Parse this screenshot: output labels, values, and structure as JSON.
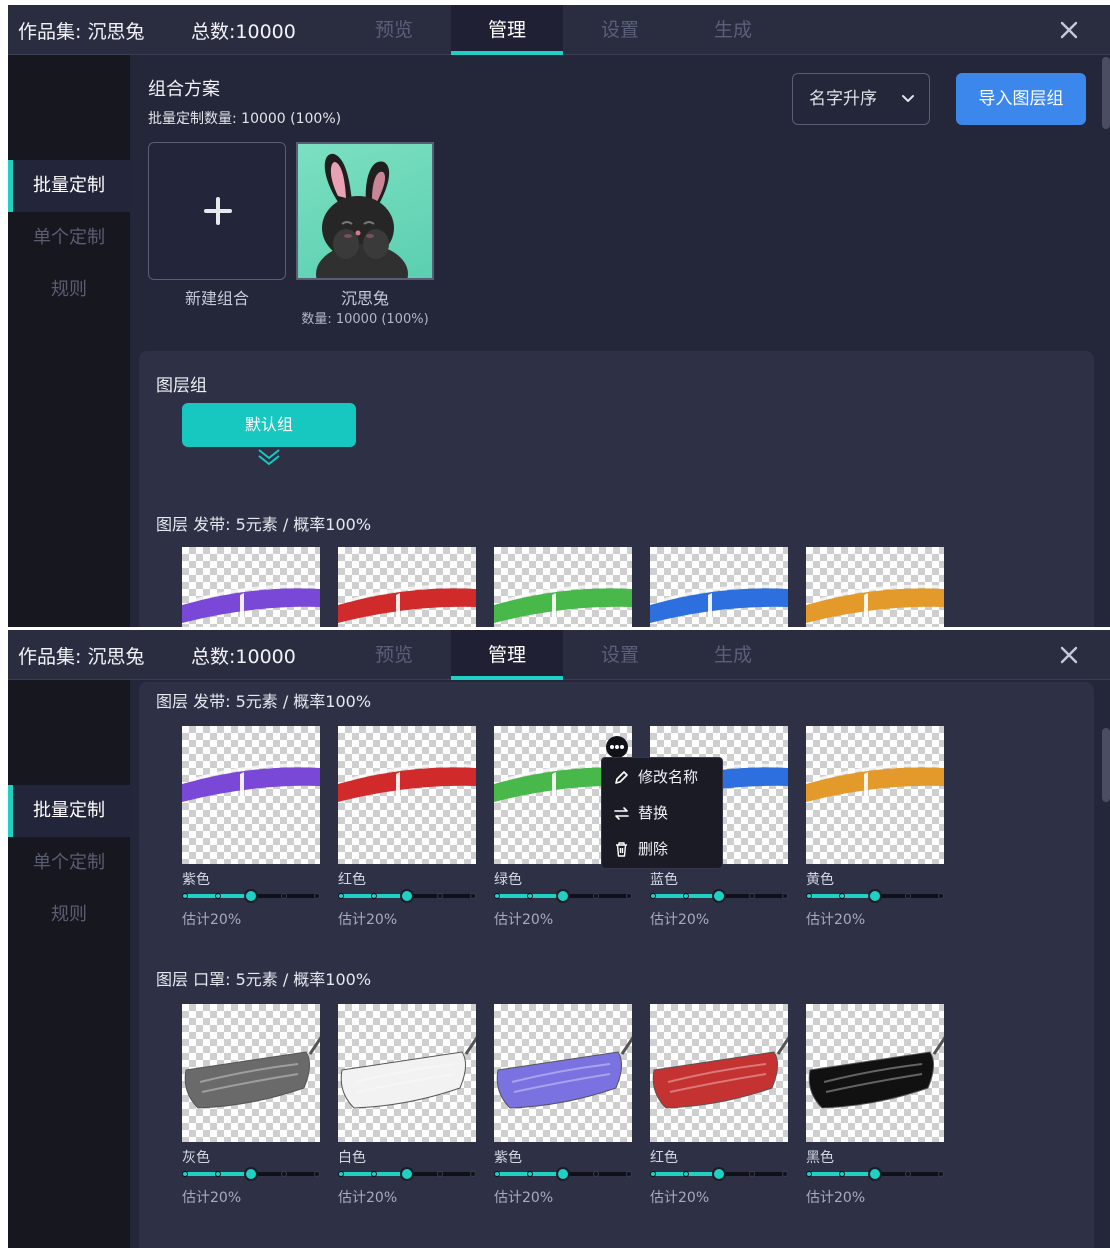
{
  "app": {
    "title": "作品集: 沉思兔",
    "total": "总数:10000",
    "tabs": [
      {
        "label": "预览",
        "active": false
      },
      {
        "label": "管理",
        "active": true
      },
      {
        "label": "设置",
        "active": false
      },
      {
        "label": "生成",
        "active": false
      }
    ],
    "close_icon": "close-icon"
  },
  "sidebar": {
    "items": [
      {
        "label": "批量定制",
        "active": true
      },
      {
        "label": "单个定制",
        "active": false
      },
      {
        "label": "规则",
        "active": false
      }
    ]
  },
  "combo": {
    "title": "组合方案",
    "batch_count": "批量定制数量: 10000 (100%)",
    "sort_value": "名字升序",
    "import_label": "导入图层组",
    "new_label": "新建组合",
    "item_name": "沉思兔",
    "item_count": "数量: 10000 (100%)"
  },
  "layer_groups": {
    "title": "图层组",
    "default_group": "默认组"
  },
  "layers": [
    {
      "header": "图层 发带: 5元素 / 概率100%",
      "elements": [
        {
          "name": "紫色",
          "estimate": "估计20%",
          "color": "#7a48d6",
          "level": 0.5
        },
        {
          "name": "红色",
          "estimate": "估计20%",
          "color": "#d12a2a",
          "level": 0.5
        },
        {
          "name": "绿色",
          "estimate": "估计20%",
          "color": "#48b84a",
          "level": 0.5
        },
        {
          "name": "蓝色",
          "estimate": "估计20%",
          "color": "#2e6fe0",
          "level": 0.5
        },
        {
          "name": "黄色",
          "estimate": "估计20%",
          "color": "#e39a2a",
          "level": 0.5
        }
      ]
    },
    {
      "header": "图层 口罩: 5元素 / 概率100%",
      "elements": [
        {
          "name": "灰色",
          "estimate": "估计20%",
          "color": "#6a6a6a",
          "level": 0.5
        },
        {
          "name": "白色",
          "estimate": "估计20%",
          "color": "#f2f2f2",
          "level": 0.5
        },
        {
          "name": "紫色",
          "estimate": "估计20%",
          "color": "#7a72e0",
          "level": 0.5
        },
        {
          "name": "红色",
          "estimate": "估计20%",
          "color": "#c53232",
          "level": 0.5
        },
        {
          "name": "黑色",
          "estimate": "估计20%",
          "color": "#111111",
          "level": 0.5
        }
      ]
    }
  ],
  "context_menu": {
    "items": [
      {
        "label": "修改名称",
        "icon": "pencil-icon"
      },
      {
        "label": "替换",
        "icon": "swap-icon"
      },
      {
        "label": "删除",
        "icon": "trash-icon"
      }
    ]
  },
  "colors": {
    "accent": "#1fd0c3",
    "primary": "#3b87ec",
    "background": "#24263a",
    "sidebar": "#16171f"
  }
}
